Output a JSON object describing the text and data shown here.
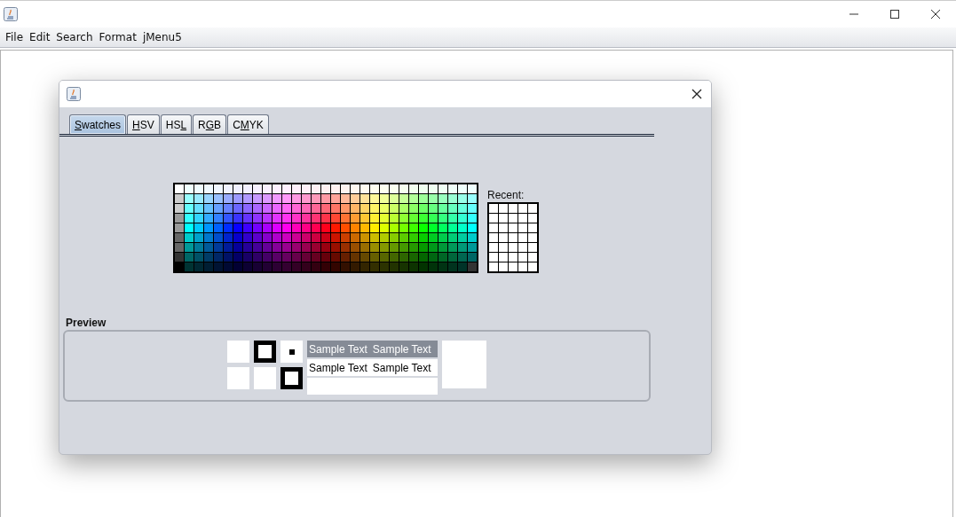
{
  "menu": [
    "File",
    "Edit",
    "Search",
    "Format",
    "jMenu5"
  ],
  "dialog": {
    "tabs": [
      {
        "key": "S",
        "post": "watches",
        "selected": true
      },
      {
        "key": "H",
        "post": "SV",
        "selected": false
      },
      {
        "pre": "HS",
        "key": "L",
        "selected": false
      },
      {
        "pre": "R",
        "key": "G",
        "post": "B",
        "selected": false
      },
      {
        "pre": "C",
        "key": "M",
        "post": "YK",
        "selected": false
      }
    ],
    "recent_label": "Recent:",
    "preview": {
      "title": "Preview",
      "text_rows": [
        {
          "kind": "light",
          "texts": [
            "Sample Text",
            "Sample Text"
          ]
        },
        {
          "kind": "dark",
          "texts": [
            "Sample Text",
            "Sample Text"
          ]
        }
      ]
    }
  }
}
